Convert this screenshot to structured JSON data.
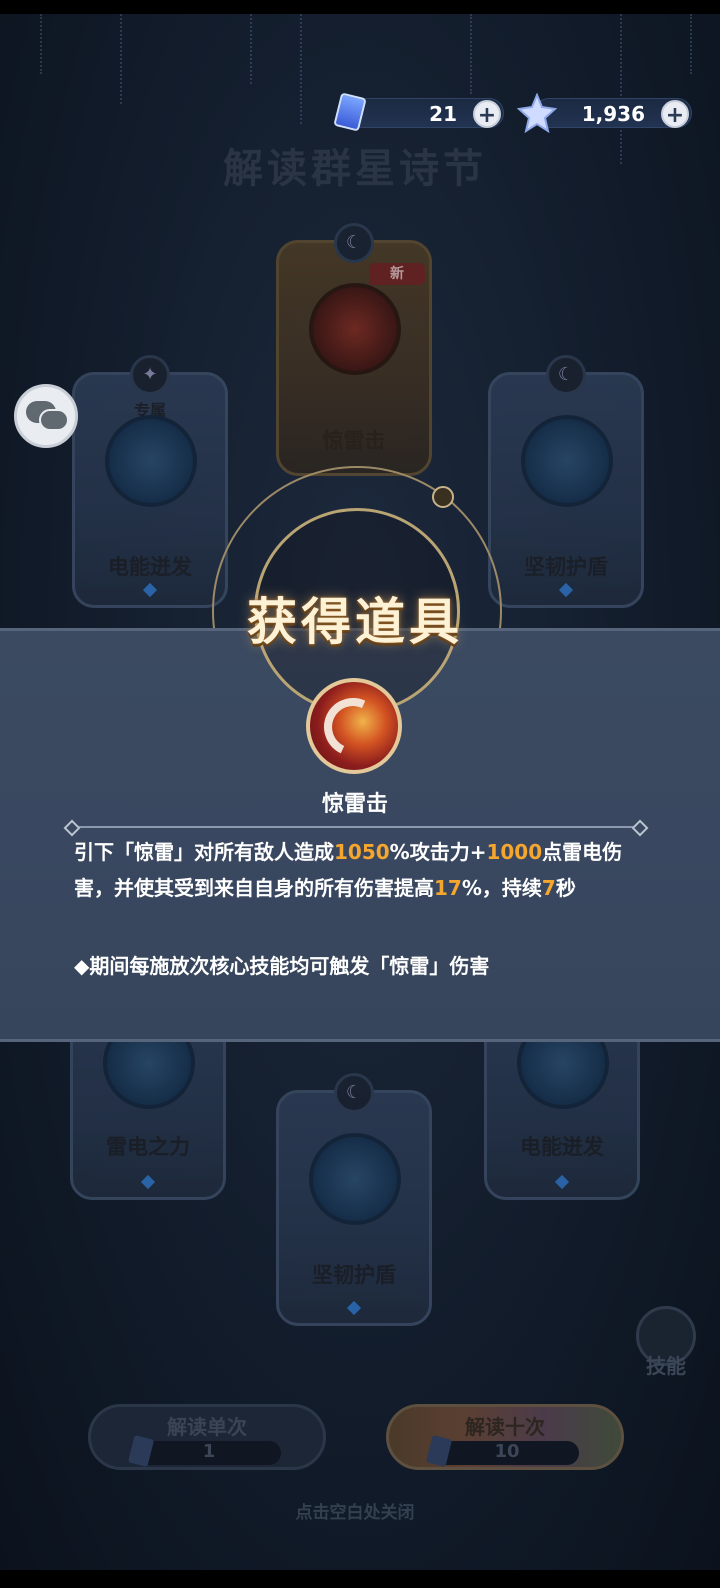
{
  "currency": {
    "tickets": "21",
    "stars": "1,936"
  },
  "page_title": "解读群星诗节",
  "cards": {
    "top_center": {
      "label": "惊雷击",
      "badge": "新"
    },
    "left": {
      "label": "电能迸发",
      "sub": "专属"
    },
    "right": {
      "label": "坚韧护盾"
    },
    "bottom_left": {
      "label": "雷电之力"
    },
    "bottom_right": {
      "label": "电能迸发"
    },
    "bottom_center": {
      "label": "坚韧护盾"
    }
  },
  "modal": {
    "title": "获得道具",
    "item_name": "惊雷击",
    "desc_parts": {
      "p1": "引下「惊雷」对所有敌人造成",
      "v1": "1050",
      "p2": "%攻击力+",
      "v2": "1000",
      "p3": "点雷电伤害，并使其受到来自自身的所有伤害提高",
      "v3": "17",
      "p4": "%，持续",
      "v4": "7",
      "p5": "秒"
    },
    "note": "◆期间每施放次核心技能均可触发「惊雷」伤害"
  },
  "buttons": {
    "skill": "技能",
    "single": {
      "label": "解读单次",
      "count": "1"
    },
    "ten": {
      "label": "解读十次",
      "count": "10"
    }
  },
  "close_hint": "点击空白处关闭",
  "colors": {
    "highlight": "#f4a62e",
    "band": "#394860",
    "title_glow": "#fdf1d6"
  }
}
